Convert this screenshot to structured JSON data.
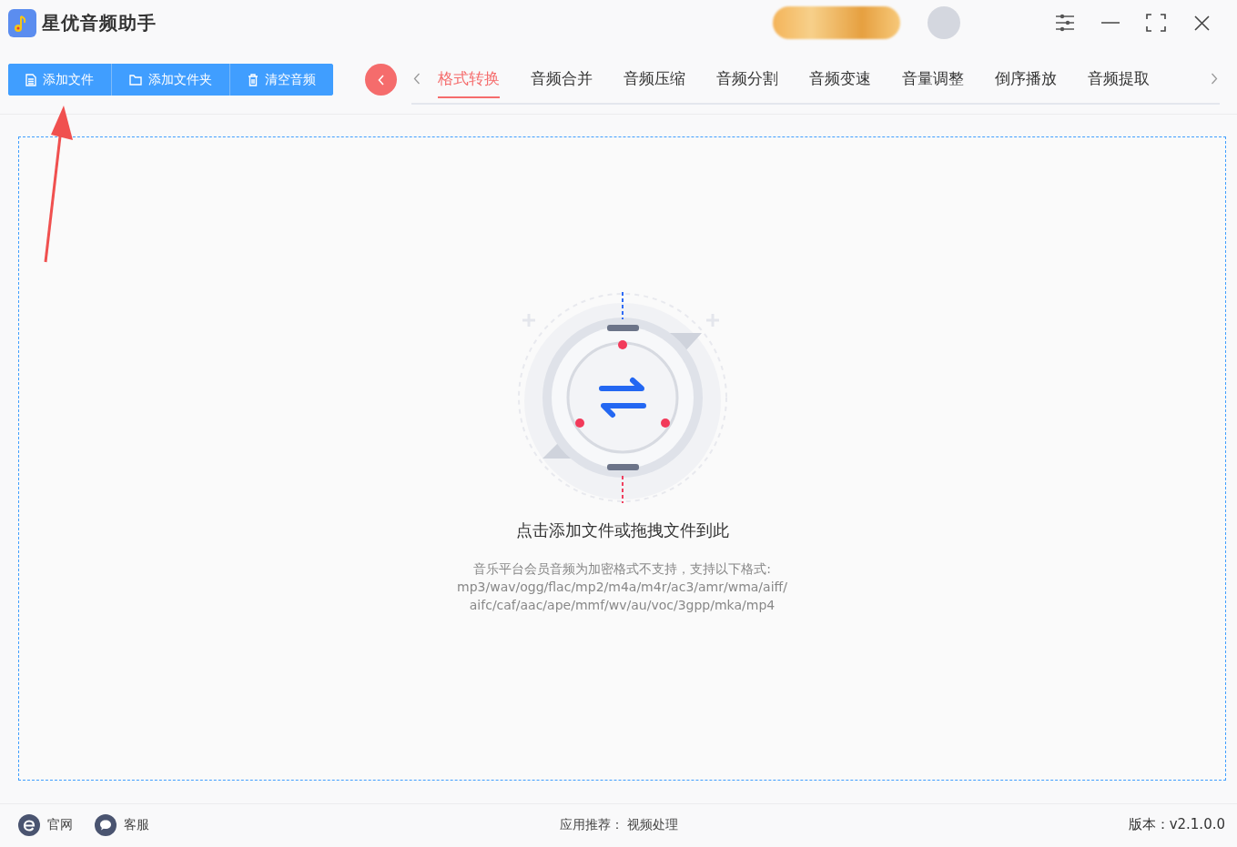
{
  "app": {
    "title": "星优音频助手"
  },
  "toolbar_buttons": [
    {
      "label": "添加文件",
      "kind": "file"
    },
    {
      "label": "添加文件夹",
      "kind": "folder"
    },
    {
      "label": "清空音频",
      "kind": "trash"
    }
  ],
  "tabs": [
    {
      "label": "格式转换",
      "selected": true
    },
    {
      "label": "音频合并",
      "selected": false
    },
    {
      "label": "音频压缩",
      "selected": false
    },
    {
      "label": "音频分割",
      "selected": false
    },
    {
      "label": "音频变速",
      "selected": false
    },
    {
      "label": "音量调整",
      "selected": false
    },
    {
      "label": "倒序播放",
      "selected": false
    },
    {
      "label": "音频提取",
      "selected": false
    }
  ],
  "drop_zone": {
    "title": "点击添加文件或拖拽文件到此",
    "notes": [
      "音乐平台会员音频为加密格式不支持，支持以下格式:",
      "mp3/wav/ogg/flac/mp2/m4a/m4r/ac3/amr/wma/aiff/",
      "aifc/caf/aac/ape/mmf/wv/au/voc/3gpp/mka/mp4"
    ]
  },
  "footer": {
    "links": [
      {
        "label": "官网",
        "kind": "web"
      },
      {
        "label": "客服",
        "kind": "chat"
      }
    ],
    "recommend_label": "应用推荐：",
    "recommend_link": "视频处理",
    "version": "版本：v2.1.0.0"
  }
}
